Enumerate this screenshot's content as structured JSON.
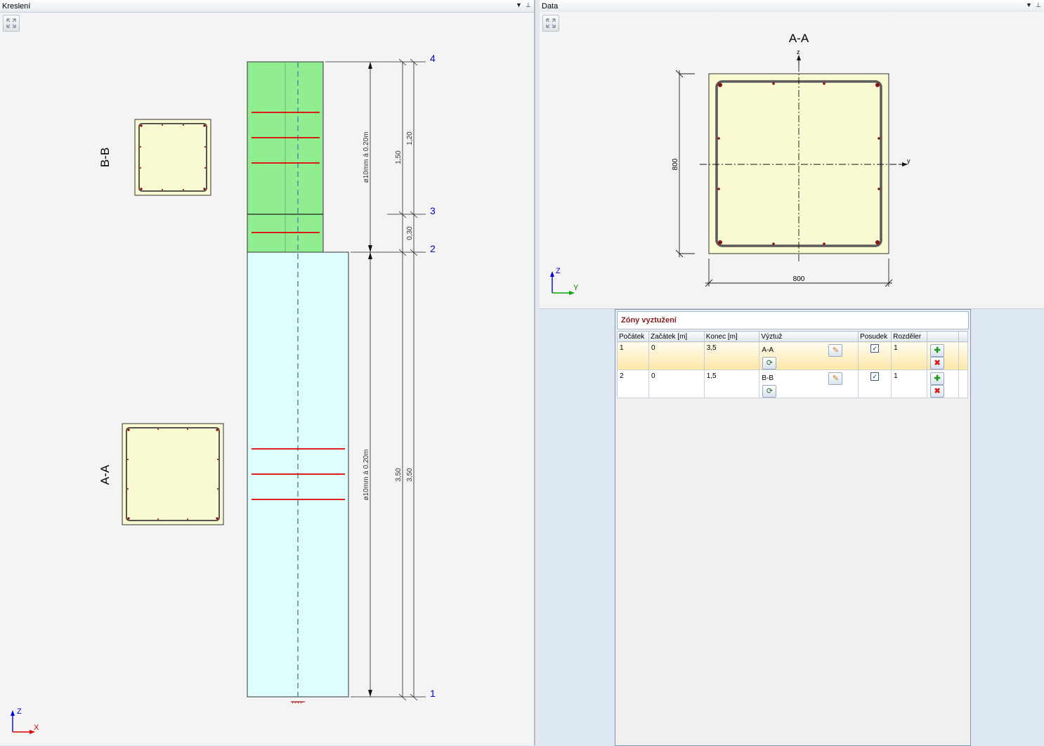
{
  "left_panel": {
    "title": "Kreslení",
    "menu": "▼",
    "pin": "⊥"
  },
  "right_panel": {
    "title": "Data",
    "menu": "▼",
    "pin": "⊥"
  },
  "drawing": {
    "section_bb_label": "B-B",
    "section_aa_label": "A-A",
    "dim_1_20": "1,20",
    "dim_1_50": "1,50",
    "dim_0_30": "0,30",
    "dim_3_50_a": "3,50",
    "dim_3_50_b": "3,50",
    "stirrup_upper": "ø10mm á 0.20m",
    "stirrup_lower": "ø10mm á 0.20m",
    "nodes": [
      "4",
      "3",
      "2",
      "1"
    ],
    "axis_z": "Z",
    "axis_x": "X"
  },
  "section_view": {
    "title": "A-A",
    "axis_z": "z",
    "axis_y": "y",
    "height_dim": "800",
    "width_dim": "800",
    "axis_Z": "Z",
    "axis_Y": "Y"
  },
  "zones": {
    "title": "Zóny vyztužení",
    "columns": [
      "Počátek",
      "Začátek [m]",
      "Konec [m]",
      "Výztuž",
      "Posudek",
      "Rozděler"
    ],
    "rows": [
      {
        "pocatek": "1",
        "zacatek": "0",
        "konec": "3,5",
        "vyztuz": "A-A",
        "posudek": true,
        "rozdeler": "1"
      },
      {
        "pocatek": "2",
        "zacatek": "0",
        "konec": "1,5",
        "vyztuz": "B-B",
        "posudek": true,
        "rozdeler": "1"
      }
    ]
  },
  "colors": {
    "upper_segment": "#90ee90",
    "lower_segment": "#dfffff",
    "section_fill": "#fafad2",
    "stirrup": "#e00000",
    "node_label": "#0000cc"
  }
}
